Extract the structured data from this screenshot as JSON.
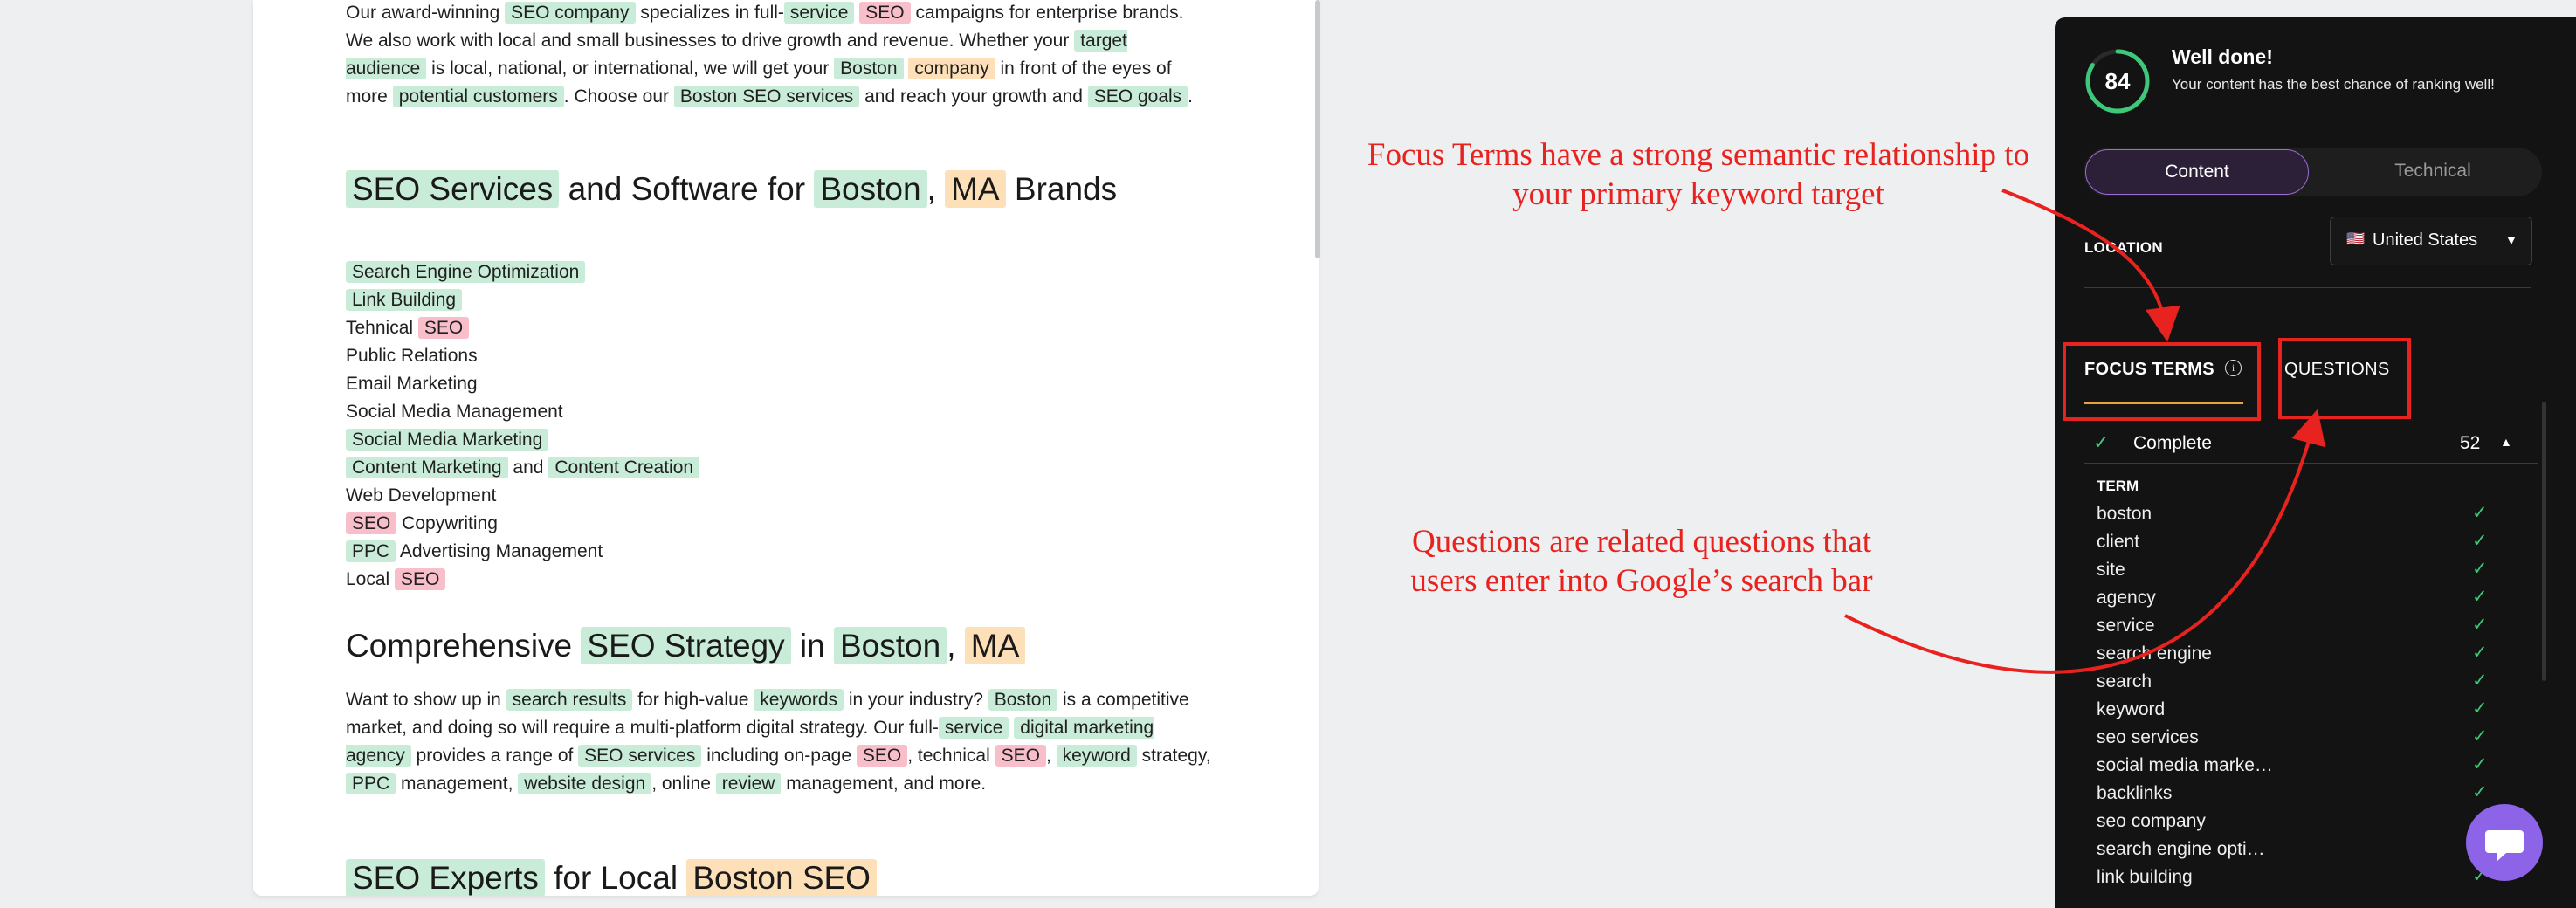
{
  "document": {
    "intro_paragraph": [
      {
        "t": "Our award-winning "
      },
      {
        "t": "SEO company",
        "h": "g"
      },
      {
        "t": " specializes in full-"
      },
      {
        "t": "service",
        "h": "g"
      },
      {
        "t": " "
      },
      {
        "t": "SEO",
        "h": "r"
      },
      {
        "t": " campaigns for enterprise brands. We also work with local and small businesses to drive growth and revenue. Whether your "
      },
      {
        "t": "target audience",
        "h": "g"
      },
      {
        "t": " is local, national, or international, we will get your "
      },
      {
        "t": "Boston",
        "h": "g"
      },
      {
        "t": " "
      },
      {
        "t": "company",
        "h": "o"
      },
      {
        "t": " in front of the eyes of more "
      },
      {
        "t": "potential customers",
        "h": "g"
      },
      {
        "t": ". Choose our "
      },
      {
        "t": "Boston SEO services",
        "h": "g"
      },
      {
        "t": " and reach your growth and "
      },
      {
        "t": "SEO goals",
        "h": "g"
      },
      {
        "t": "."
      }
    ],
    "heading1": [
      {
        "t": "SEO Services",
        "h": "g"
      },
      {
        "t": " and Software for "
      },
      {
        "t": "Boston",
        "h": "g"
      },
      {
        "t": ", "
      },
      {
        "t": "MA",
        "h": "o"
      },
      {
        "t": " Brands"
      }
    ],
    "list": [
      [
        {
          "t": "Search Engine Optimization",
          "h": "g"
        }
      ],
      [
        {
          "t": "Link Building",
          "h": "g"
        }
      ],
      [
        {
          "t": "Tehnical "
        },
        {
          "t": "SEO",
          "h": "r"
        }
      ],
      [
        {
          "t": "Public Relations"
        }
      ],
      [
        {
          "t": "Email Marketing"
        }
      ],
      [
        {
          "t": "Social Media Management"
        }
      ],
      [
        {
          "t": "Social Media Marketing",
          "h": "g"
        }
      ],
      [
        {
          "t": "Content Marketing",
          "h": "g"
        },
        {
          "t": " and "
        },
        {
          "t": "Content Creation",
          "h": "g"
        }
      ],
      [
        {
          "t": "Web Development"
        }
      ],
      [
        {
          "t": "SEO",
          "h": "r"
        },
        {
          "t": " Copywriting"
        }
      ],
      [
        {
          "t": "PPC",
          "h": "g"
        },
        {
          "t": " Advertising Management"
        }
      ],
      [
        {
          "t": "Local "
        },
        {
          "t": "SEO",
          "h": "r"
        }
      ]
    ],
    "heading2": [
      {
        "t": "Comprehensive "
      },
      {
        "t": "SEO Strategy",
        "h": "g"
      },
      {
        "t": " in "
      },
      {
        "t": "Boston",
        "h": "g"
      },
      {
        "t": ", "
      },
      {
        "t": "MA",
        "h": "o"
      }
    ],
    "paragraph2": [
      {
        "t": "Want to show up in "
      },
      {
        "t": "search results",
        "h": "g"
      },
      {
        "t": " for high-value "
      },
      {
        "t": "keywords",
        "h": "g"
      },
      {
        "t": " in your industry? "
      },
      {
        "t": "Boston",
        "h": "g"
      },
      {
        "t": " is a competitive market, and doing so will require a multi-platform digital strategy. Our full-"
      },
      {
        "t": "service",
        "h": "g"
      },
      {
        "t": " "
      },
      {
        "t": "digital marketing agency",
        "h": "g"
      },
      {
        "t": " provides a range of "
      },
      {
        "t": "SEO services",
        "h": "g"
      },
      {
        "t": " including on-page "
      },
      {
        "t": "SEO",
        "h": "r"
      },
      {
        "t": ", technical "
      },
      {
        "t": "SEO",
        "h": "r"
      },
      {
        "t": ", "
      },
      {
        "t": "keyword",
        "h": "g"
      },
      {
        "t": " strategy, "
      },
      {
        "t": "PPC",
        "h": "g"
      },
      {
        "t": " management, "
      },
      {
        "t": "website design",
        "h": "g"
      },
      {
        "t": ", online "
      },
      {
        "t": "review",
        "h": "g"
      },
      {
        "t": " management, and more."
      }
    ],
    "heading3": [
      {
        "t": "SEO Experts",
        "h": "g"
      },
      {
        "t": " for Local "
      },
      {
        "t": "Boston SEO",
        "h": "o"
      }
    ]
  },
  "panel": {
    "score": "84",
    "score_fraction": 0.84,
    "score_color": "#3ec97a",
    "status_title": "Well done!",
    "status_subtitle": "Your content has the best chance of ranking well!",
    "tabs": {
      "content": "Content",
      "technical": "Technical"
    },
    "location_label": "LOCATION",
    "location_flag": "🇺🇸",
    "location_value": "United States",
    "focus_terms_tab": "FOCUS TERMS",
    "questions_tab": "QUESTIONS",
    "complete_label": "Complete",
    "complete_count": "52",
    "term_header": "TERM",
    "terms": [
      "boston",
      "client",
      "site",
      "agency",
      "service",
      "search engine",
      "search",
      "keyword",
      "seo services",
      "social media marke…",
      "backlinks",
      "seo company",
      "search engine opti…",
      "link building"
    ]
  },
  "annotations": {
    "focus_terms_note": "Focus Terms have a strong semantic relationship to your primary keyword target",
    "questions_note": "Questions are related questions that users enter into Google’s search bar"
  },
  "colors": {
    "highlight_green": "#c9ecd8",
    "highlight_red": "#f8bfca",
    "highlight_orange": "#fde0b8",
    "annotation_red": "#e8231f",
    "accent_purple": "#8d64e8"
  }
}
